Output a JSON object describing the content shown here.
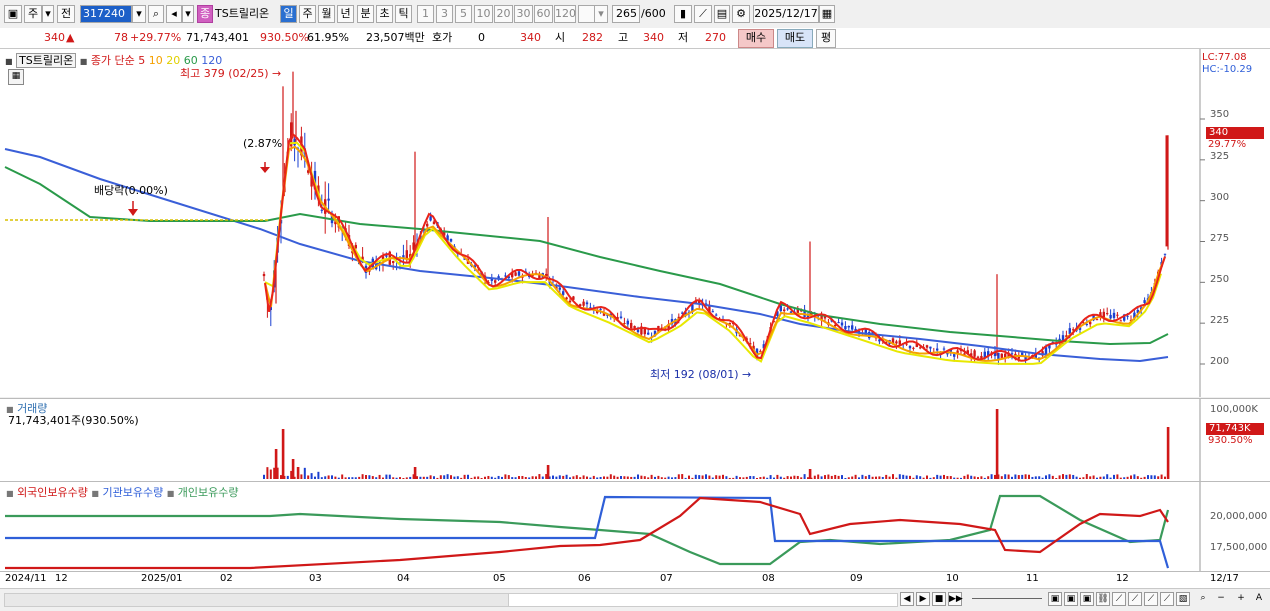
{
  "toolbar": {
    "period_week": "주",
    "period_all": "전",
    "code": "317240",
    "tag_jong": "종",
    "stock_name": "TS트릴리온",
    "periods": [
      "일",
      "주",
      "월",
      "년",
      "분",
      "초",
      "틱"
    ],
    "active_period": "일",
    "intervals": [
      "1",
      "3",
      "5",
      "10",
      "20",
      "30",
      "60",
      "120"
    ],
    "count": "265",
    "count_total": "/600",
    "date": "2025/12/17"
  },
  "infobar": {
    "price": "340",
    "change": "78",
    "change_pct": "+29.77%",
    "volume": "71,743,401",
    "volume_pct": "930.50%",
    "turnover": "61.95%",
    "amount": "23,507백만",
    "hoga_label": "호가",
    "hoga_val": "0",
    "hoga_price": "340",
    "open_label": "시",
    "open": "282",
    "high_label": "고",
    "high": "340",
    "low_label": "저",
    "low": "270",
    "buy": "매수",
    "sell": "매도",
    "eval": "평"
  },
  "price_panel": {
    "name_tag": "TS트릴리온",
    "ma_label": "종가 단순",
    "ma_periods": [
      "5",
      "10",
      "20",
      "60",
      "120"
    ],
    "ma_colors": [
      "#e8231a",
      "#f5a000",
      "#e8e800",
      "#2a9a4a",
      "#3a5fd8"
    ],
    "lc": "LC:77.08",
    "hc": "HC:-10.29",
    "high_note": "최고 379 (02/25)",
    "low_note": "최저 192 (08/01)",
    "pct_note": "(2.87%",
    "div_note": "배당락(0.00%)",
    "price_flag": "340",
    "pct_flag": "29.77%",
    "y_ticks": [
      "350",
      "325",
      "300",
      "275",
      "250",
      "225",
      "200"
    ]
  },
  "volume_panel": {
    "title": "거래량",
    "value": "71,743,401주(930.50%)",
    "top_tick": "100,000K",
    "flag": "71,743K",
    "flag_pct": "930.50%"
  },
  "holder_panel": {
    "legend": [
      "외국인보유수량",
      "기관보유수량",
      "개인보유수량"
    ],
    "legend_colors": [
      "#d01818",
      "#2f5fd8",
      "#3a9a5a"
    ],
    "y_ticks": [
      "20,000,000",
      "17,500,000"
    ]
  },
  "xaxis": {
    "labels": [
      "2024/11",
      "12",
      "2025/01",
      "02",
      "03",
      "04",
      "05",
      "06",
      "07",
      "08",
      "09",
      "10",
      "11",
      "12"
    ],
    "end_label": "12/17"
  },
  "chart_data": [
    {
      "type": "candlestick",
      "title": "TS트릴리온",
      "ylim": [
        185,
        385
      ],
      "series": [
        {
          "name": "종가 단순 5",
          "values": [
            262,
            230,
            300,
            330,
            285,
            268,
            270,
            255,
            255,
            230,
            220,
            230,
            205,
            220,
            208,
            205,
            200,
            198,
            225,
            225,
            235,
            340
          ]
        },
        {
          "name": "120",
          "values": [
            360,
            330,
            300,
            285,
            282,
            275,
            270,
            262,
            257,
            250,
            242,
            235,
            228,
            222,
            220
          ]
        }
      ],
      "annotations": [
        "최고 379 (02/25)",
        "최저 192 (08/01)",
        "배당락(0.00%)"
      ]
    },
    {
      "type": "bar",
      "title": "거래량",
      "ylabel": "100,000K",
      "values": [
        71743
      ]
    },
    {
      "type": "line",
      "series": [
        {
          "name": "외국인보유수량"
        },
        {
          "name": "기관보유수량"
        },
        {
          "name": "개인보유수량"
        }
      ]
    }
  ]
}
